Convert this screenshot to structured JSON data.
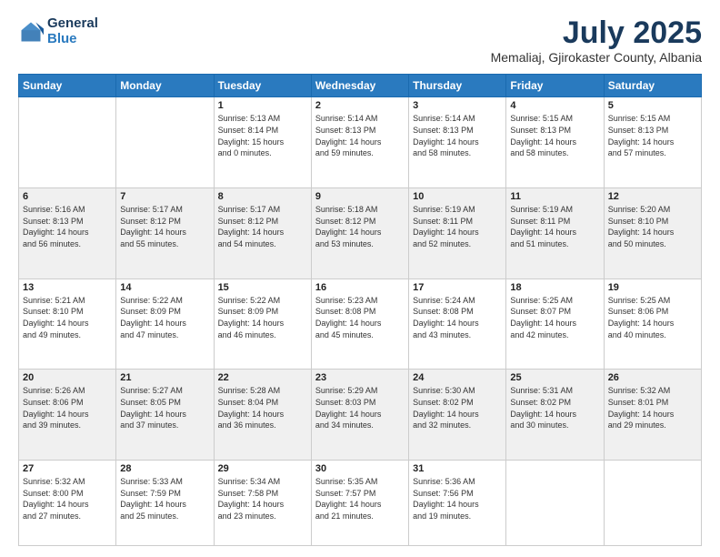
{
  "header": {
    "logo": {
      "general": "General",
      "blue": "Blue"
    },
    "title": "July 2025",
    "subtitle": "Memaliaj, Gjirokaster County, Albania"
  },
  "calendar": {
    "days_of_week": [
      "Sunday",
      "Monday",
      "Tuesday",
      "Wednesday",
      "Thursday",
      "Friday",
      "Saturday"
    ],
    "weeks": [
      [
        {
          "day": "",
          "info": ""
        },
        {
          "day": "",
          "info": ""
        },
        {
          "day": "1",
          "info": "Sunrise: 5:13 AM\nSunset: 8:14 PM\nDaylight: 15 hours\nand 0 minutes."
        },
        {
          "day": "2",
          "info": "Sunrise: 5:14 AM\nSunset: 8:13 PM\nDaylight: 14 hours\nand 59 minutes."
        },
        {
          "day": "3",
          "info": "Sunrise: 5:14 AM\nSunset: 8:13 PM\nDaylight: 14 hours\nand 58 minutes."
        },
        {
          "day": "4",
          "info": "Sunrise: 5:15 AM\nSunset: 8:13 PM\nDaylight: 14 hours\nand 58 minutes."
        },
        {
          "day": "5",
          "info": "Sunrise: 5:15 AM\nSunset: 8:13 PM\nDaylight: 14 hours\nand 57 minutes."
        }
      ],
      [
        {
          "day": "6",
          "info": "Sunrise: 5:16 AM\nSunset: 8:13 PM\nDaylight: 14 hours\nand 56 minutes."
        },
        {
          "day": "7",
          "info": "Sunrise: 5:17 AM\nSunset: 8:12 PM\nDaylight: 14 hours\nand 55 minutes."
        },
        {
          "day": "8",
          "info": "Sunrise: 5:17 AM\nSunset: 8:12 PM\nDaylight: 14 hours\nand 54 minutes."
        },
        {
          "day": "9",
          "info": "Sunrise: 5:18 AM\nSunset: 8:12 PM\nDaylight: 14 hours\nand 53 minutes."
        },
        {
          "day": "10",
          "info": "Sunrise: 5:19 AM\nSunset: 8:11 PM\nDaylight: 14 hours\nand 52 minutes."
        },
        {
          "day": "11",
          "info": "Sunrise: 5:19 AM\nSunset: 8:11 PM\nDaylight: 14 hours\nand 51 minutes."
        },
        {
          "day": "12",
          "info": "Sunrise: 5:20 AM\nSunset: 8:10 PM\nDaylight: 14 hours\nand 50 minutes."
        }
      ],
      [
        {
          "day": "13",
          "info": "Sunrise: 5:21 AM\nSunset: 8:10 PM\nDaylight: 14 hours\nand 49 minutes."
        },
        {
          "day": "14",
          "info": "Sunrise: 5:22 AM\nSunset: 8:09 PM\nDaylight: 14 hours\nand 47 minutes."
        },
        {
          "day": "15",
          "info": "Sunrise: 5:22 AM\nSunset: 8:09 PM\nDaylight: 14 hours\nand 46 minutes."
        },
        {
          "day": "16",
          "info": "Sunrise: 5:23 AM\nSunset: 8:08 PM\nDaylight: 14 hours\nand 45 minutes."
        },
        {
          "day": "17",
          "info": "Sunrise: 5:24 AM\nSunset: 8:08 PM\nDaylight: 14 hours\nand 43 minutes."
        },
        {
          "day": "18",
          "info": "Sunrise: 5:25 AM\nSunset: 8:07 PM\nDaylight: 14 hours\nand 42 minutes."
        },
        {
          "day": "19",
          "info": "Sunrise: 5:25 AM\nSunset: 8:06 PM\nDaylight: 14 hours\nand 40 minutes."
        }
      ],
      [
        {
          "day": "20",
          "info": "Sunrise: 5:26 AM\nSunset: 8:06 PM\nDaylight: 14 hours\nand 39 minutes."
        },
        {
          "day": "21",
          "info": "Sunrise: 5:27 AM\nSunset: 8:05 PM\nDaylight: 14 hours\nand 37 minutes."
        },
        {
          "day": "22",
          "info": "Sunrise: 5:28 AM\nSunset: 8:04 PM\nDaylight: 14 hours\nand 36 minutes."
        },
        {
          "day": "23",
          "info": "Sunrise: 5:29 AM\nSunset: 8:03 PM\nDaylight: 14 hours\nand 34 minutes."
        },
        {
          "day": "24",
          "info": "Sunrise: 5:30 AM\nSunset: 8:02 PM\nDaylight: 14 hours\nand 32 minutes."
        },
        {
          "day": "25",
          "info": "Sunrise: 5:31 AM\nSunset: 8:02 PM\nDaylight: 14 hours\nand 30 minutes."
        },
        {
          "day": "26",
          "info": "Sunrise: 5:32 AM\nSunset: 8:01 PM\nDaylight: 14 hours\nand 29 minutes."
        }
      ],
      [
        {
          "day": "27",
          "info": "Sunrise: 5:32 AM\nSunset: 8:00 PM\nDaylight: 14 hours\nand 27 minutes."
        },
        {
          "day": "28",
          "info": "Sunrise: 5:33 AM\nSunset: 7:59 PM\nDaylight: 14 hours\nand 25 minutes."
        },
        {
          "day": "29",
          "info": "Sunrise: 5:34 AM\nSunset: 7:58 PM\nDaylight: 14 hours\nand 23 minutes."
        },
        {
          "day": "30",
          "info": "Sunrise: 5:35 AM\nSunset: 7:57 PM\nDaylight: 14 hours\nand 21 minutes."
        },
        {
          "day": "31",
          "info": "Sunrise: 5:36 AM\nSunset: 7:56 PM\nDaylight: 14 hours\nand 19 minutes."
        },
        {
          "day": "",
          "info": ""
        },
        {
          "day": "",
          "info": ""
        }
      ]
    ]
  }
}
